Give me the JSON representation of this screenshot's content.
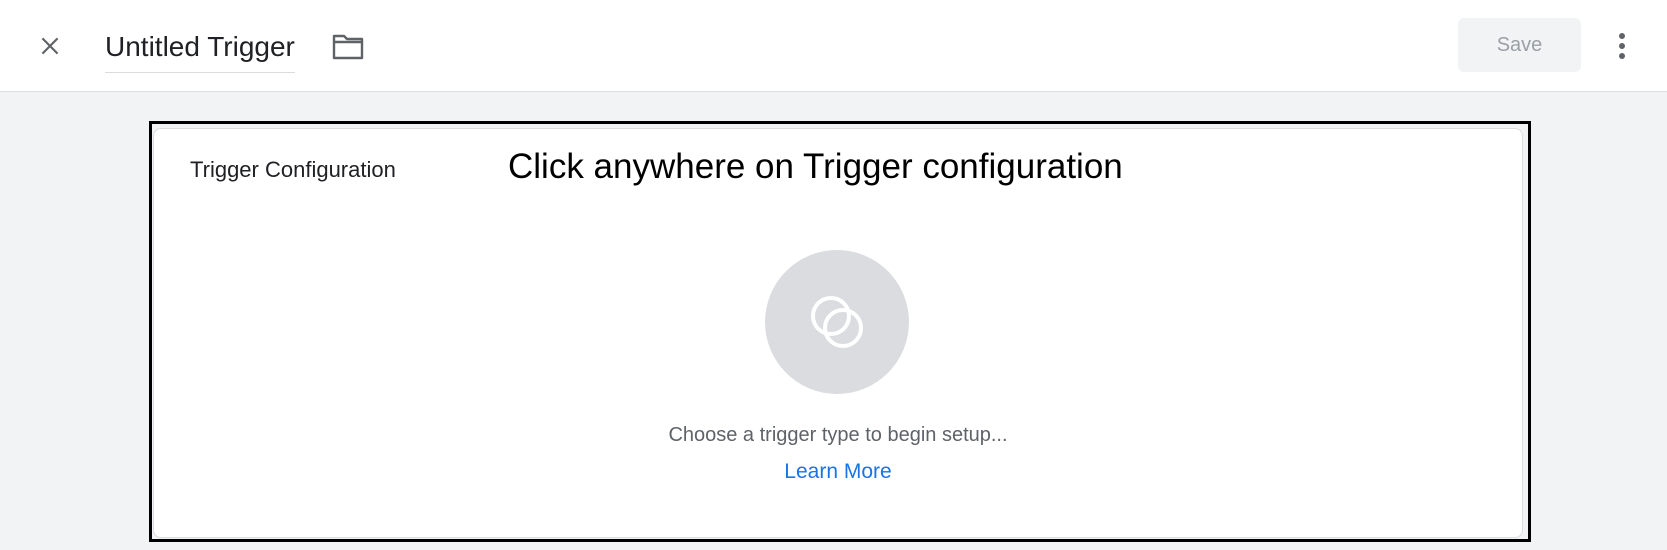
{
  "header": {
    "title": "Untitled Trigger",
    "save_label": "Save",
    "icons": {
      "close": "close-icon",
      "folder": "folder-icon",
      "more": "more-vert-icon"
    }
  },
  "card": {
    "title": "Trigger Configuration",
    "instruction": "Click anywhere on Trigger configuration",
    "hint": "Choose a trigger type to begin setup...",
    "learn_more": "Learn More",
    "placeholder_icon": "trigger-circles-icon"
  },
  "colors": {
    "accent": "#1a73e8",
    "circle_bg": "#dadce0",
    "page_bg": "#f1f3f4"
  }
}
